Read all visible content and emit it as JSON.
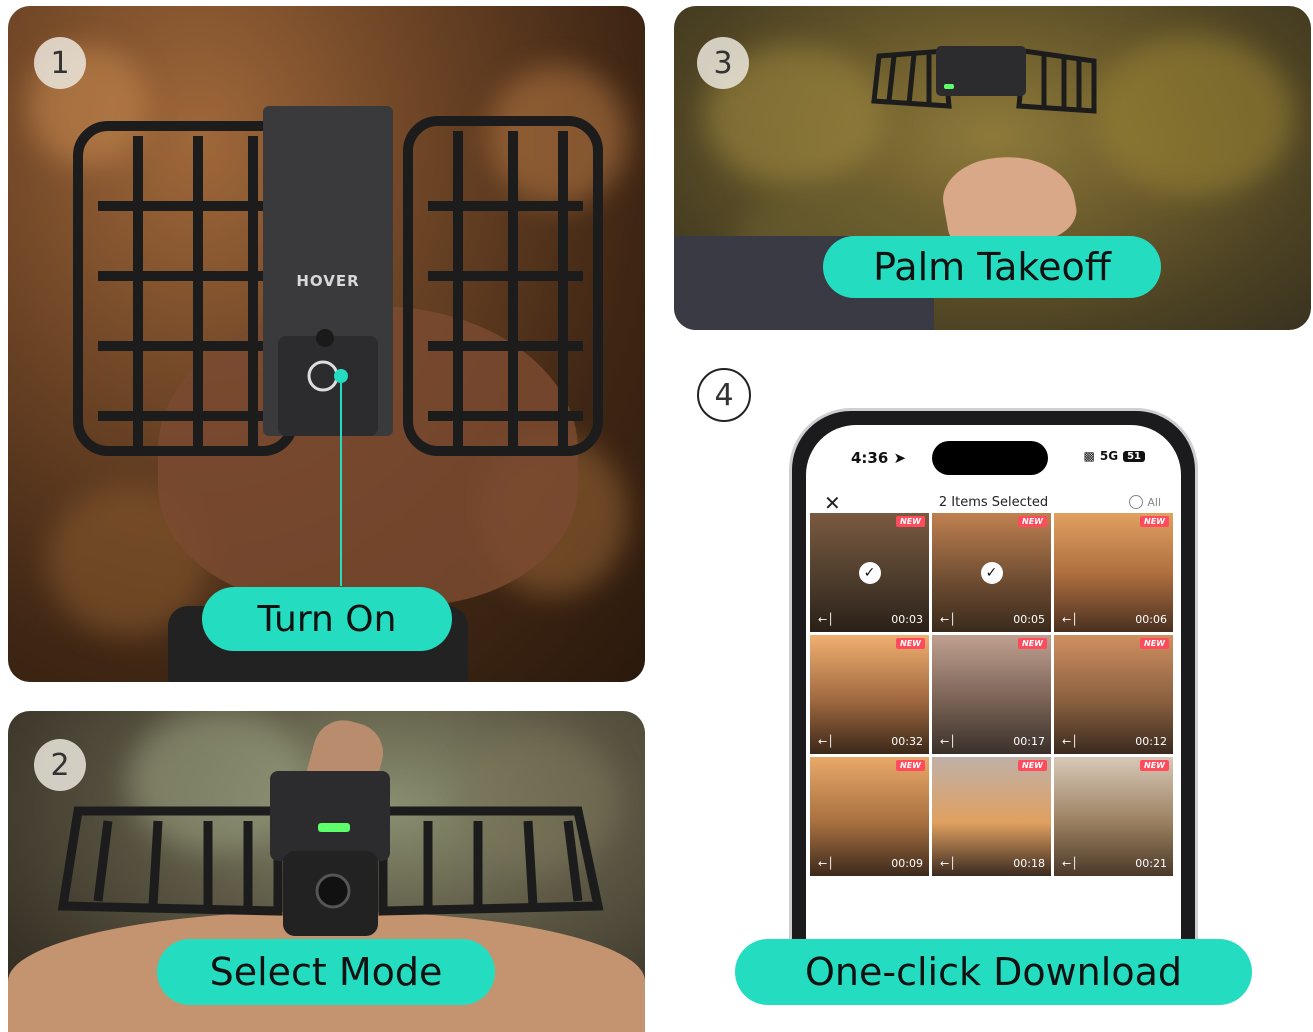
{
  "steps": [
    {
      "number": "1",
      "label": "Turn On"
    },
    {
      "number": "2",
      "label": "Select Mode"
    },
    {
      "number": "3",
      "label": "Palm Takeoff"
    },
    {
      "number": "4",
      "label": "One-click Download"
    }
  ],
  "drone": {
    "brand": "HOVER"
  },
  "phone": {
    "status": {
      "time": "4:36",
      "network": "5G",
      "battery": "51"
    },
    "title": "2 Items Selected",
    "select_all_label": "All",
    "new_label": "NEW",
    "thumbnails": [
      {
        "duration": "00:03",
        "selected": true
      },
      {
        "duration": "00:05",
        "selected": true
      },
      {
        "duration": "00:06",
        "selected": false
      },
      {
        "duration": "00:32",
        "selected": false
      },
      {
        "duration": "00:17",
        "selected": false
      },
      {
        "duration": "00:12",
        "selected": false
      },
      {
        "duration": "00:09",
        "selected": false
      },
      {
        "duration": "00:18",
        "selected": false
      },
      {
        "duration": "00:21",
        "selected": false
      }
    ]
  },
  "colors": {
    "accent": "#24ddc0",
    "new_badge": "#ff4b5c"
  },
  "icons": [
    "close-icon",
    "location-arrow-icon",
    "signal-icon",
    "battery-icon",
    "check-icon",
    "radio-icon"
  ]
}
